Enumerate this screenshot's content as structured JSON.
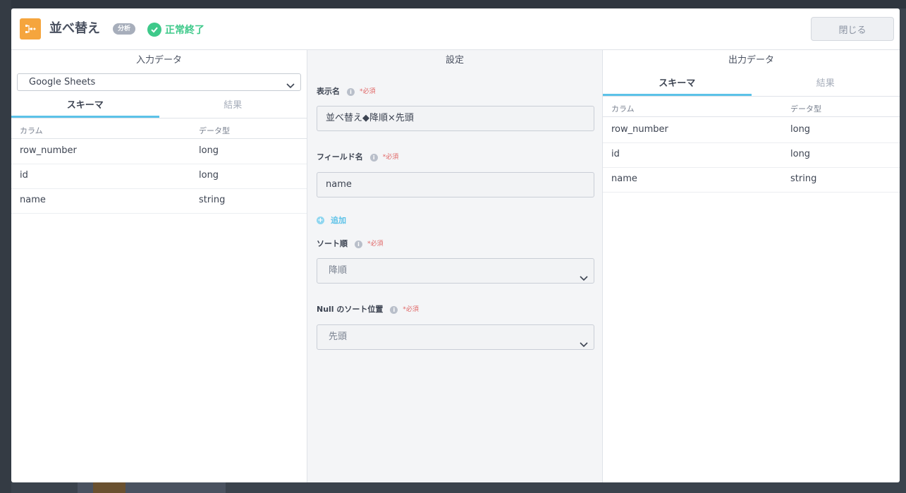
{
  "header": {
    "title": "並べ替え",
    "badge": "分析",
    "status": "正常終了",
    "close_label": "閉じる"
  },
  "input_panel": {
    "title": "入力データ",
    "source_select": "Google Sheets",
    "tabs": [
      "スキーマ",
      "結果"
    ],
    "columns_header": "カラム",
    "type_header": "データ型",
    "rows": [
      {
        "column": "row_number",
        "type": "long"
      },
      {
        "column": "id",
        "type": "long"
      },
      {
        "column": "name",
        "type": "string"
      }
    ]
  },
  "settings_panel": {
    "title": "設定",
    "required_mark": "*必須",
    "info_glyph": "i",
    "add_glyph": "+",
    "display_name": {
      "label": "表示名",
      "value": "並べ替え◆降順×先頭"
    },
    "field_name": {
      "label": "フィールド名",
      "value": "name"
    },
    "add_label": "追加",
    "sort_order": {
      "label": "ソート順",
      "value": "降順"
    },
    "null_position": {
      "label": "Null のソート位置",
      "value": "先頭"
    }
  },
  "output_panel": {
    "title": "出力データ",
    "tabs": [
      "スキーマ",
      "結果"
    ],
    "columns_header": "カラム",
    "type_header": "データ型",
    "rows": [
      {
        "column": "row_number",
        "type": "long"
      },
      {
        "column": "id",
        "type": "long"
      },
      {
        "column": "name",
        "type": "string"
      }
    ]
  },
  "colors": {
    "accent": "#5cc2e8",
    "success": "#3ec98a",
    "app_icon": "#f5a53d",
    "required": "#e06666"
  },
  "icons": [
    "sort-app-icon",
    "check-circle-icon",
    "chevron-down-icon",
    "info-icon",
    "add-circle-icon"
  ]
}
